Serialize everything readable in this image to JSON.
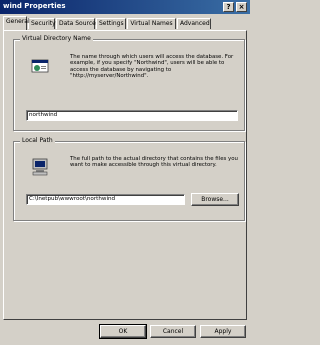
{
  "window": {
    "title": "wind Properties",
    "help_glyph": "?",
    "close_glyph": "×"
  },
  "tabs": [
    {
      "label": "General",
      "active": true
    },
    {
      "label": "Security",
      "active": false
    },
    {
      "label": "Data Source",
      "active": false
    },
    {
      "label": "Settings",
      "active": false
    },
    {
      "label": "Virtual Names",
      "active": false
    },
    {
      "label": "Advanced",
      "active": false
    }
  ],
  "virtual_directory": {
    "group_label": "Virtual Directory Name",
    "description": "The name through which users will access the database. For example, if you specify \"Northwind\", users will be able to access the database by navigating to \"http://myserver/Northwind\".",
    "value": "northwind",
    "icon": "web-folder-icon"
  },
  "local_path": {
    "group_label": "Local Path",
    "description": "The full path to the actual directory that contains the files you want to make accessible through this virtual directory.",
    "value": "C:\\Inetpub\\wwwroot\\northwind",
    "browse_label": "Browse...",
    "icon": "computer-icon"
  },
  "buttons": {
    "ok": "OK",
    "cancel": "Cancel",
    "apply": "Apply"
  }
}
